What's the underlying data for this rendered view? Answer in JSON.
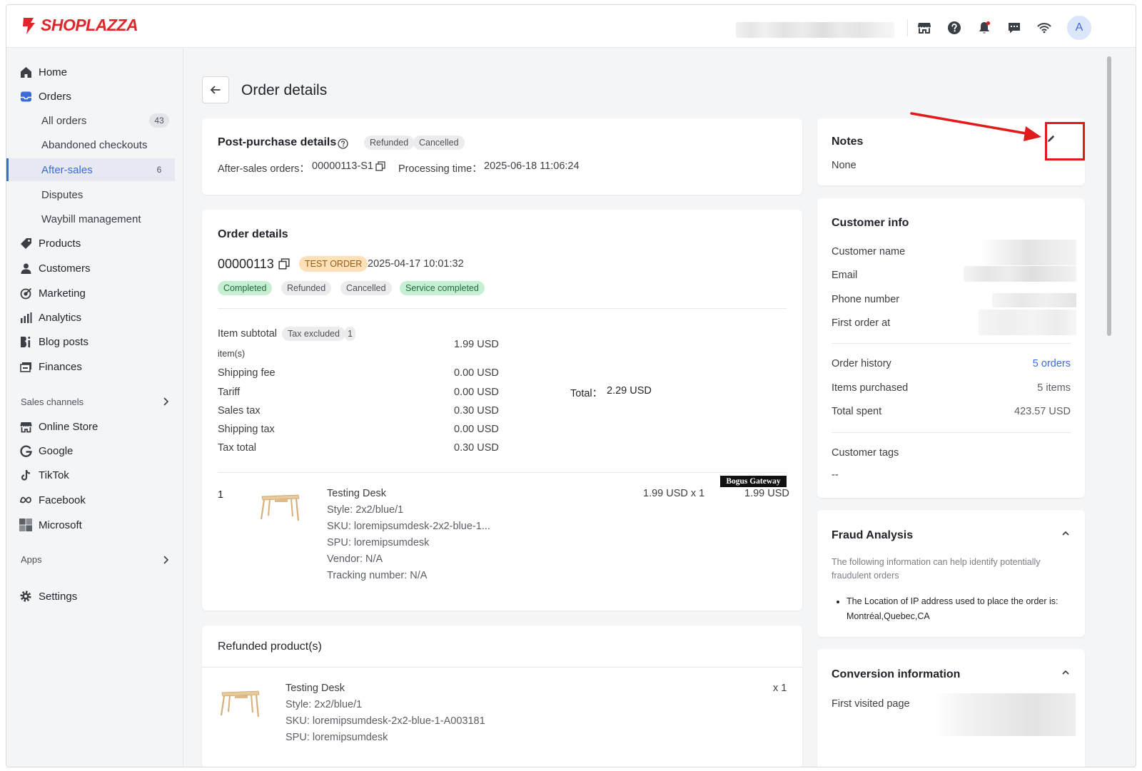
{
  "brand": {
    "name": "SHOPLAZZA",
    "color": "#e0262b"
  },
  "header": {
    "avatar_letter": "A",
    "icons": [
      "store-icon",
      "help-icon",
      "bell-icon",
      "chat-icon",
      "wifi-icon"
    ]
  },
  "sidebar": {
    "home": "Home",
    "orders": "Orders",
    "all_orders": "All orders",
    "all_orders_count": "43",
    "abandoned_checkouts": "Abandoned checkouts",
    "after_sales": "After-sales",
    "after_sales_count": "6",
    "disputes": "Disputes",
    "waybill": "Waybill management",
    "products": "Products",
    "customers": "Customers",
    "marketing": "Marketing",
    "analytics": "Analytics",
    "blog_posts": "Blog posts",
    "finances": "Finances",
    "sales_channels": "Sales channels",
    "online_store": "Online Store",
    "google": "Google",
    "tiktok": "TikTok",
    "facebook": "Facebook",
    "microsoft": "Microsoft",
    "apps": "Apps",
    "settings": "Settings"
  },
  "page": {
    "title": "Order details"
  },
  "post_purchase": {
    "title": "Post-purchase details",
    "tags": [
      "Refunded",
      "Cancelled"
    ],
    "after_sales_label": "After-sales orders：",
    "after_sales_value": "00000113-S1",
    "processing_label": "Processing time：",
    "processing_value": "2025-06-18 11:06:24"
  },
  "order": {
    "title": "Order details",
    "number": "00000113",
    "test_tag": "TEST ORDER",
    "datetime": "2025-04-17 10:01:32",
    "statuses": [
      "Completed",
      "Refunded",
      "Cancelled",
      "Service completed"
    ],
    "subtotal_label": "Item subtotal",
    "tax_excluded": "Tax excluded",
    "item_count": "1",
    "items_suffix": "item(s)",
    "subtotal_value": "1.99 USD",
    "rows": [
      {
        "label": "Shipping fee",
        "value": "0.00 USD"
      },
      {
        "label": "Tariff",
        "value": "0.00 USD"
      },
      {
        "label": "Sales tax",
        "value": "0.30 USD"
      },
      {
        "label": "Shipping tax",
        "value": "0.00 USD"
      },
      {
        "label": "Tax total",
        "value": "0.30 USD"
      }
    ],
    "total_label": "Total：",
    "total_value": "2.29 USD",
    "gateway": "Bogus Gateway",
    "line_item": {
      "index": "1",
      "name": "Testing Desk",
      "style": "Style: 2x2/blue/1",
      "sku": "SKU: loremipsumdesk-2x2-blue-1...",
      "spu": "SPU: loremipsumdesk",
      "vendor": "Vendor: N/A",
      "tracking": "Tracking number: N/A",
      "unit": "1.99 USD x 1",
      "amount": "1.99 USD"
    }
  },
  "refunded": {
    "title": "Refunded product(s)",
    "name": "Testing Desk",
    "style": "Style: 2x2/blue/1",
    "sku": "SKU: loremipsumdesk-2x2-blue-1-A003181",
    "spu": "SPU: loremipsumdesk",
    "qty": "x 1"
  },
  "notes": {
    "title": "Notes",
    "value": "None"
  },
  "customer": {
    "title": "Customer info",
    "name_label": "Customer name",
    "email_label": "Email",
    "phone_label": "Phone number",
    "first_order_label": "First order at",
    "history_label": "Order history",
    "history_value": "5 orders",
    "items_label": "Items purchased",
    "items_value": "5 items",
    "spent_label": "Total spent",
    "spent_value": "423.57 USD",
    "tags_label": "Customer tags",
    "tags_value": "--"
  },
  "fraud": {
    "title": "Fraud Analysis",
    "desc_line1": "The following information can help identify potentially",
    "desc_line2": "fraudulent orders",
    "bullet_line1": "The Location of IP address used to place the order is:",
    "bullet_line2": "Montréal,Quebec,CA"
  },
  "conversion": {
    "title": "Conversion information",
    "first_page_label": "First visited page"
  },
  "colors": {
    "accent": "#3b6bd6",
    "annotation": "#e01b1b",
    "success_bg": "#c6efd4",
    "test_bg": "#fde0b7"
  }
}
